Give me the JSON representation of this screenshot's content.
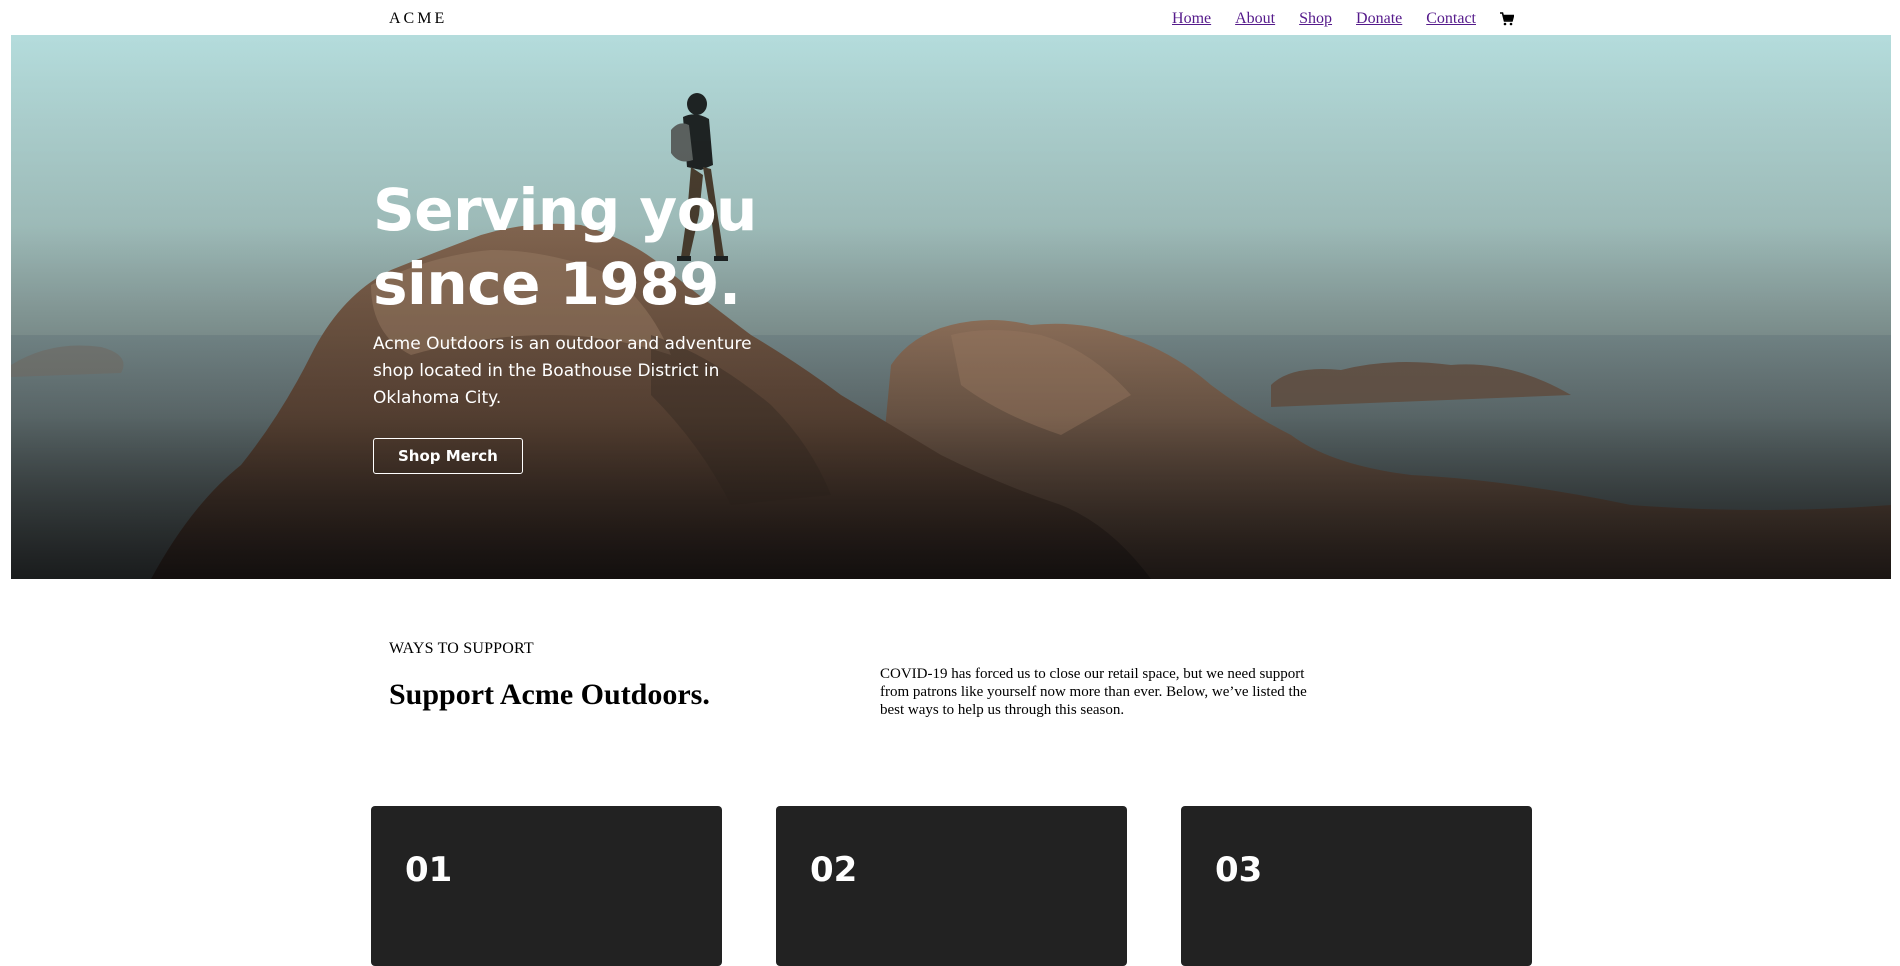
{
  "nav": {
    "brand": "ACME",
    "links": [
      "Home",
      "About",
      "Shop",
      "Donate",
      "Contact"
    ],
    "cart_icon": "cart-icon",
    "link_color": "#551a8b"
  },
  "hero": {
    "title": "Serving you\nsince 1989.",
    "text": "Acme Outdoors is an outdoor and adventure shop located in the Boathouse District in Oklahoma City.",
    "button": "Shop Merch"
  },
  "support": {
    "kicker": "WAYS TO SUPPORT",
    "title": "Support Acme Outdoors.",
    "description": "COVID-19 has forced us to close our retail space, but we need support from patrons like yourself now more than ever. Below, we’ve listed the best ways to help us through this season."
  },
  "cards": [
    {
      "number": "01"
    },
    {
      "number": "02"
    },
    {
      "number": "03"
    }
  ],
  "colors": {
    "card_bg": "#222222",
    "hero_text": "#ffffff"
  }
}
